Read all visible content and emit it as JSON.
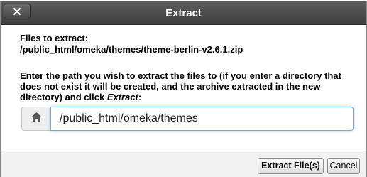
{
  "dialog": {
    "title": "Extract",
    "files_label": "Files to extract:",
    "file_path": "/public_html/omeka/themes/theme-berlin-v2.6.1.zip",
    "instructions_main": "Enter the path you wish to extract the files to (if you enter a directory that does not exist it will be created, and the archive extracted in the new directory) and click ",
    "instructions_action": "Extract",
    "instructions_end": ":",
    "path_value": "/public_html/omeka/themes",
    "extract_button": "Extract File(s)",
    "cancel_button": "Cancel"
  },
  "icons": {
    "close": "close-icon",
    "home": "home-icon"
  },
  "colors": {
    "titlebar": "#4a4a4a",
    "input_focus": "#66afe9",
    "footer_bg": "#f2f2f2"
  }
}
